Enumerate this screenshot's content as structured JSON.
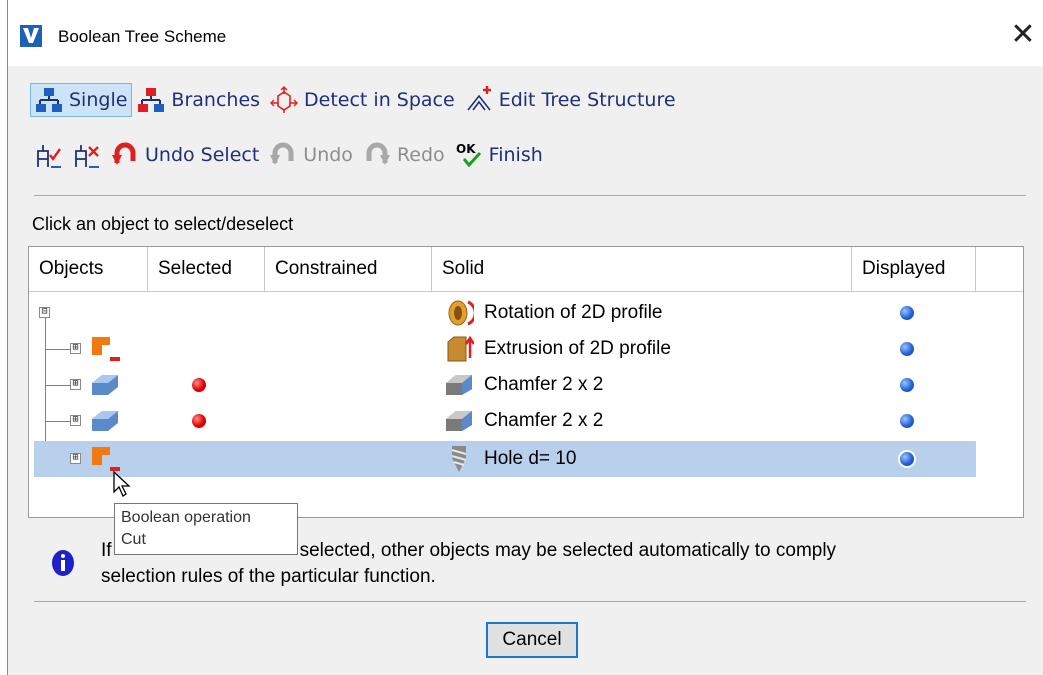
{
  "window": {
    "title": "Boolean Tree Scheme",
    "close_symbol": "✕"
  },
  "toolbar_row1": [
    {
      "label": "Single",
      "icon": "tree-single-icon",
      "active": true
    },
    {
      "label": "Branches",
      "icon": "tree-branches-icon"
    },
    {
      "label": "Detect in Space",
      "icon": "detect-space-icon"
    },
    {
      "label": "Edit Tree Structure",
      "icon": "edit-tree-icon"
    }
  ],
  "toolbar_row2": [
    {
      "label": "",
      "icon": "select-all-icon"
    },
    {
      "label": "",
      "icon": "deselect-all-icon"
    },
    {
      "label": "Undo Select",
      "icon": "undo-select-icon"
    },
    {
      "label": "Undo",
      "icon": "undo-icon",
      "disabled": true
    },
    {
      "label": "Redo",
      "icon": "redo-icon",
      "disabled": true
    },
    {
      "label": "Finish",
      "icon": "finish-ok-icon",
      "icon_text": "OK"
    }
  ],
  "hint": "Click an object to select/deselect",
  "table": {
    "columns": [
      "Objects",
      "Selected",
      "Constrained",
      "Solid",
      "Displayed"
    ],
    "rows": [
      {
        "expander": "⊟",
        "object_icon": "",
        "selected": false,
        "solid_icon": "rotation-icon",
        "solid": "Rotation of 2D profile",
        "displayed": true,
        "highlighted": false
      },
      {
        "expander": "⊞",
        "object_icon": "boolean-cut-icon",
        "selected": false,
        "solid_icon": "extrusion-icon",
        "solid": "Extrusion of 2D profile",
        "displayed": true,
        "highlighted": false
      },
      {
        "expander": "⊞",
        "object_icon": "chamfer-object-icon",
        "selected": true,
        "solid_icon": "chamfer-icon",
        "solid": "Chamfer 2 x 2",
        "displayed": true,
        "highlighted": false
      },
      {
        "expander": "⊞",
        "object_icon": "chamfer-object-icon",
        "selected": true,
        "solid_icon": "chamfer-icon",
        "solid": "Chamfer 2 x 2",
        "displayed": true,
        "highlighted": false
      },
      {
        "expander": "⊞",
        "object_icon": "boolean-cut-icon",
        "selected": false,
        "solid_icon": "hole-icon",
        "solid": "Hole d= 10",
        "displayed": true,
        "highlighted": true
      }
    ]
  },
  "tooltip": {
    "line1": "Boolean operation",
    "line2": "Cut"
  },
  "info": {
    "line1_start": "If",
    "line1_end": "selected, other objects may be selected automatically to comply",
    "line2": "selection rules of the particular function."
  },
  "buttons": {
    "cancel": "Cancel"
  },
  "colors": {
    "accent_blue": "#1e77d3",
    "selection_row": "#b8d0ec",
    "active_button": "#cce4f7",
    "toolbar_text": "#1f2f7a"
  }
}
